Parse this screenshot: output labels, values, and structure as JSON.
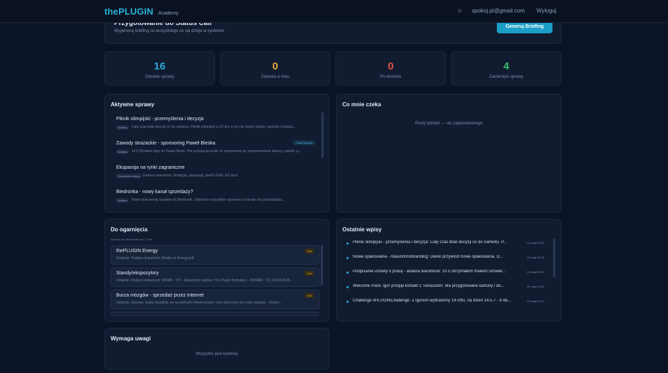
{
  "header": {
    "brand": "thePLUGIN",
    "brand_sub": "Academy",
    "settings_icon": "sun-icon",
    "email": "spokoj.pl@gmail.com",
    "logout": "Wyloguj"
  },
  "status_call": {
    "title": "Przygotowanie do Status Call",
    "subtitle": "Wygeneruj briefing ze wszystkiego co się dzieje w systemie",
    "button": "Generuj Briefing"
  },
  "stats": [
    {
      "value": "16",
      "label": "Otwarte sprawy",
      "color": "#2ba7d8"
    },
    {
      "value": "0",
      "label": "Zadania w toku",
      "color": "#e0a93b"
    },
    {
      "value": "0",
      "label": "Po terminie",
      "color": "#e0533f"
    },
    {
      "value": "4",
      "label": "Zamknięte sprawy",
      "color": "#3cc36a"
    }
  ],
  "active_cases": {
    "title": "Aktywne sprawy",
    "items": [
      {
        "title": "Piknik olimpijski - przemyślenia i decyzja",
        "tag": "Notatka",
        "desc": "Cały czas brak decyzji co do namiotu. Piknik olimpijski w 10 dni, a my nie mamy sklepy, namiotu i kubotu...",
        "badge": ""
      },
      {
        "title": "Zawody strażackie - sponsoring Paweł Bieska",
        "tag": "Notatka",
        "desc": "14.5 Wysłano logo do Pawła Bucki. Oni szykują koszulki ze sponsorami po sponsorowaniu banery, namiot, p...",
        "badge": "Paweł Bieska"
      },
      {
        "title": "Ekspansja na rynki zagraniczne",
        "tag": "Dokument dodany",
        "desc": "Dodano dokument: Strategia_ekspansji_thePLUGIN_EU.docx",
        "badge": ""
      },
      {
        "title": "Biedronka - nowy kanał sprzedaży?",
        "tag": "Notatka",
        "desc": "Nowe dokumenty wysłane do Biedronki. Założenie wszystkim sprawom w kanale nie przeszkadza...",
        "badge": ""
      }
    ]
  },
  "waiting": {
    "title": "Co mnie czeka",
    "empty": "Pusty tydzień — nic zaplanowanego"
  },
  "todo": {
    "title": "Do ogarnięcia",
    "hint": "Sprawy bez aktywności od 7+ dni",
    "items": [
      {
        "title": "thePLUGIN Energy",
        "desc": "Ostatnie: Dodano dokument: Wiality vs Energy.pdf",
        "badge": "43d"
      },
      {
        "title": "Standy/ekspozytory",
        "desc": "Ostatnie: Dodano dokument: W0488 - TPI - Ekspozytor ladowy The Plugin Hydration - 2009460 - V3_09.03.2026...",
        "badge": "43d"
      },
      {
        "title": "Burza mózgów - sprzedaż przez Internet",
        "desc": "Ostatnie: Zauważ, buduj skuplikliy się na jednoch influencerami - jest stworzyny do nowe opakow - chalen...",
        "badge": "43d"
      }
    ]
  },
  "recent": {
    "title": "Ostatnie wpisy",
    "items": [
      {
        "text": "Piknik olimpijski - przemyślenia i decyzja: Cały czas brak decyzji co do namiotu. P...",
        "date": "14 maja 20:24"
      },
      {
        "text": "Nowe opakowania - relaunch/rebranding: Darek przywiózł nowe opakowania. D...",
        "date": "14 maja 20:28"
      },
      {
        "text": "Podpisanie umowy o pracę - analiza warunków: 10.5 otrzymałem mailem umowe...",
        "date": "14 maja 20:19"
      },
      {
        "text": "Welcome Pack: Igor przejął kontakt z Tomaszem. Ma przygotowane kartony i ob...",
        "date": "14 maja 20:10"
      },
      {
        "text": "Challenge #PLUGINChallenge: Z Igorem wybraliśmy 19 influ. na dzień 14.5.7 - 8 da...",
        "date": "13 maja 20:07"
      }
    ]
  },
  "attention": {
    "title": "Wymaga uwagi",
    "empty": "Wszystko pod kontrolą"
  }
}
